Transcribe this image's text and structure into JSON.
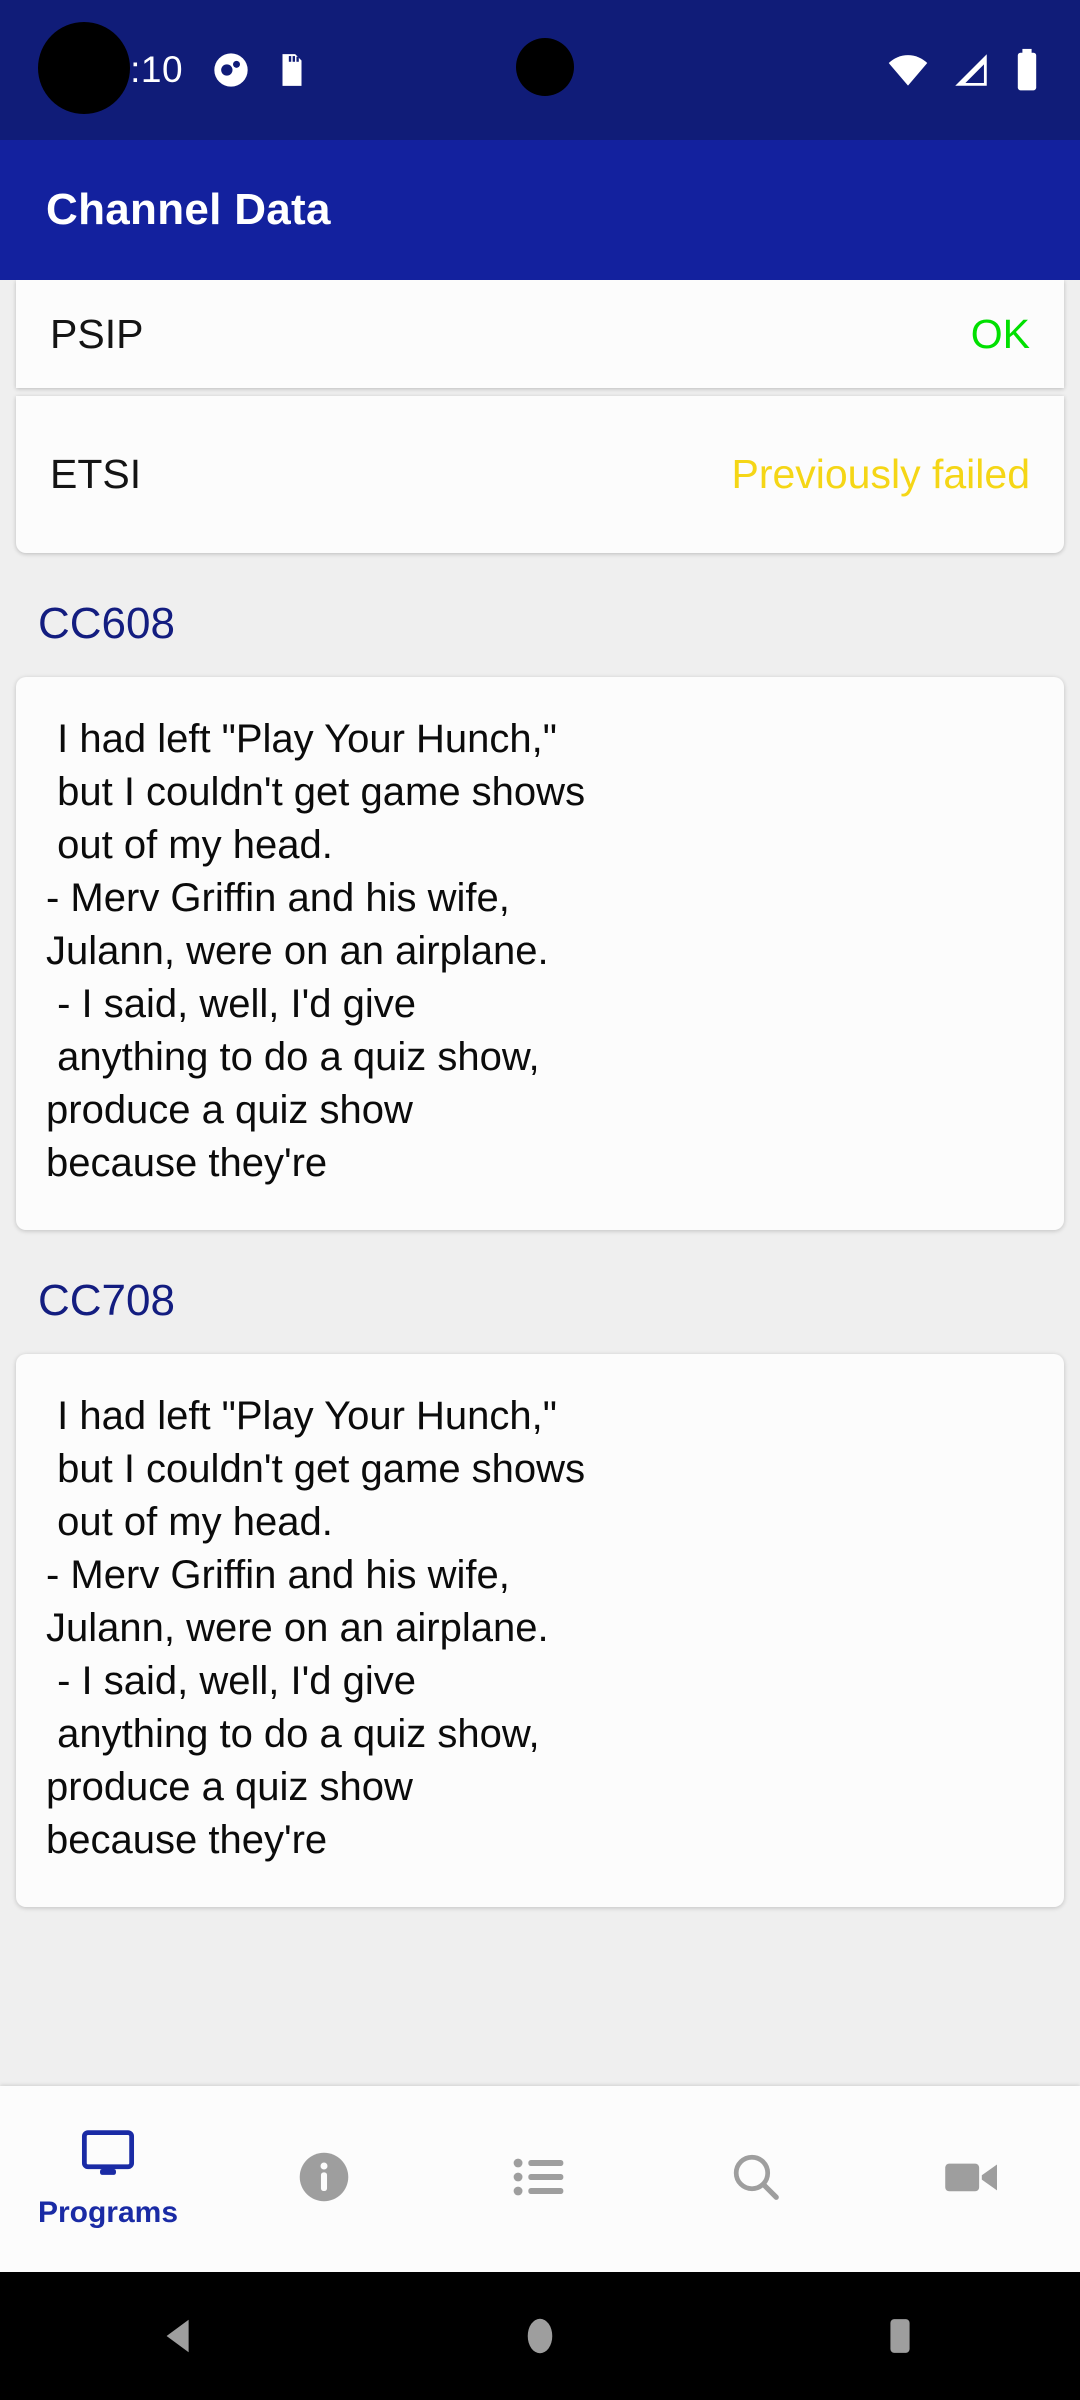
{
  "status_bar": {
    "time": "10:10",
    "icons": [
      "do-not-disturb-icon",
      "sd-card-icon",
      "wifi-icon",
      "cellular-signal-icon",
      "battery-icon"
    ],
    "background_color": "#101c78"
  },
  "app_bar": {
    "title": "Channel Data",
    "background_color": "#13219e",
    "text_color": "#ffffff"
  },
  "info_rows": [
    {
      "key": "PSIP",
      "value": "OK",
      "value_color": "#00e000"
    },
    {
      "key": "ETSI",
      "value": "Previously failed",
      "value_color": "#f5d616"
    }
  ],
  "sections": [
    {
      "title": "CC608",
      "title_color": "#131d80",
      "caption_lines": [
        " I had left \"Play Your Hunch,\"",
        " but I couldn't get game shows",
        " out of my head.",
        "- Merv Griffin and his wife,",
        "Julann, were on an airplane.",
        " - I said, well, I'd give",
        " anything to do a quiz show,",
        "produce a quiz show",
        "because they're"
      ]
    },
    {
      "title": "CC708",
      "title_color": "#131d80",
      "caption_lines": [
        " I had left \"Play Your Hunch,\"",
        " but I couldn't get game shows",
        " out of my head.",
        "- Merv Griffin and his wife,",
        "Julann, were on an airplane.",
        " - I said, well, I'd give",
        " anything to do a quiz show,",
        "produce a quiz show",
        "because they're"
      ]
    }
  ],
  "tab_bar": {
    "active_color": "#1a2ba5",
    "inactive_color": "#9e9e9e",
    "tabs": [
      {
        "icon": "tv-monitor-icon",
        "label": "Programs",
        "active": true
      },
      {
        "icon": "info-circle-icon",
        "label": "",
        "active": false
      },
      {
        "icon": "list-icon",
        "label": "",
        "active": false
      },
      {
        "icon": "search-icon",
        "label": "",
        "active": false
      },
      {
        "icon": "video-camera-icon",
        "label": "",
        "active": false
      }
    ]
  },
  "android_nav": {
    "buttons": [
      "back-icon",
      "home-icon",
      "recents-icon"
    ],
    "background_color": "#000000",
    "icon_color": "#9e9e9e"
  }
}
